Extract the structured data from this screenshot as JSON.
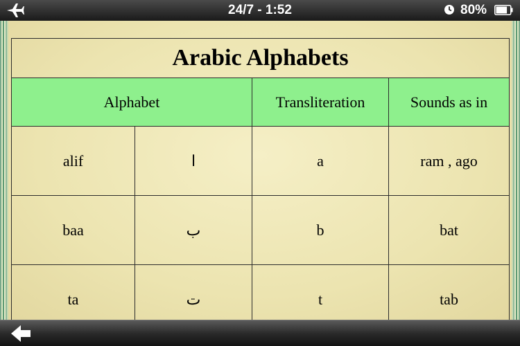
{
  "status_bar": {
    "clock": "24/7 - 1:52",
    "battery_percent": "80%",
    "battery_level": 0.8,
    "airplane_icon": "airplane-icon",
    "alarm_icon": "alarm-clock-icon"
  },
  "table": {
    "title": "Arabic Alphabets",
    "headers": {
      "alphabet": "Alphabet",
      "transliteration": "Transliteration",
      "sounds_as_in": "Sounds as in"
    },
    "rows": [
      {
        "name": "alif",
        "letter": "ا",
        "transliteration": "a",
        "sounds": "ram , ago"
      },
      {
        "name": "baa",
        "letter": "ب",
        "transliteration": "b",
        "sounds": "bat"
      },
      {
        "name": "ta",
        "letter": "ت",
        "transliteration": "t",
        "sounds": "tab"
      }
    ]
  },
  "toolbar": {
    "back_icon": "back-arrow-icon"
  },
  "colors": {
    "header_green": "#8ef08d",
    "page_background": "#ede6b4"
  }
}
